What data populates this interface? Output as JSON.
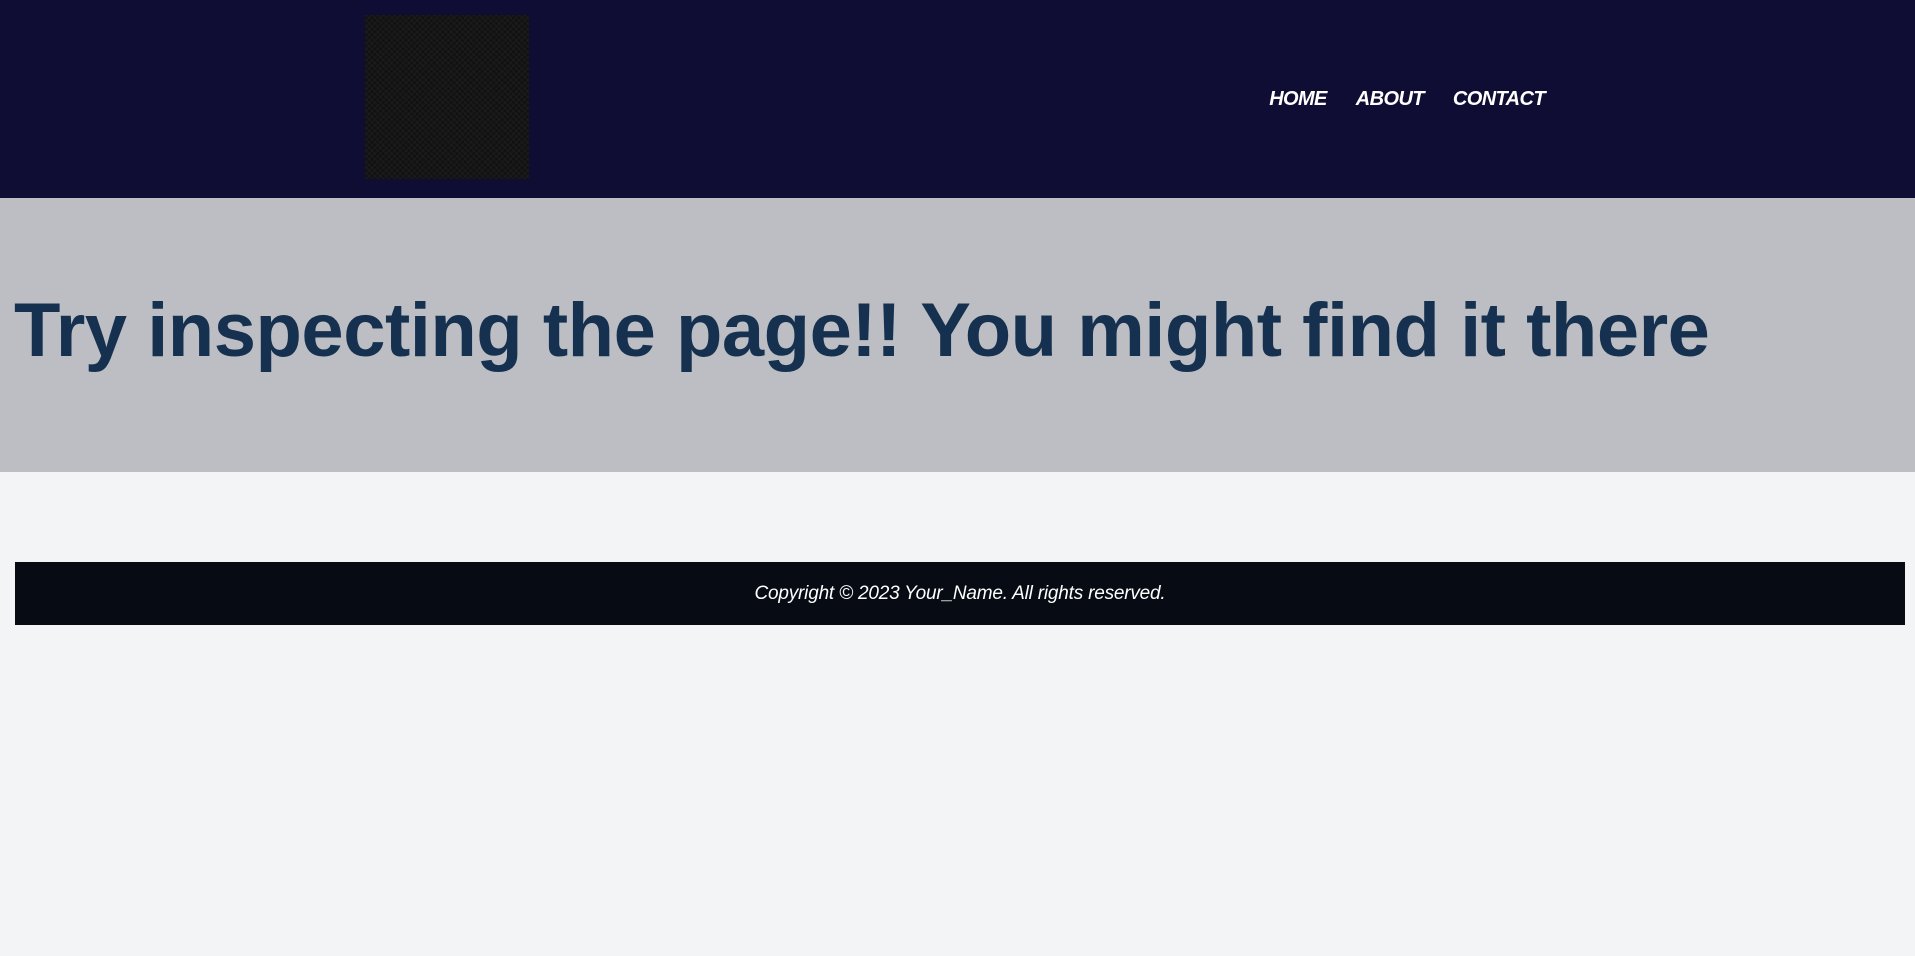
{
  "header": {
    "nav": [
      {
        "label": "HOME"
      },
      {
        "label": "ABOUT"
      },
      {
        "label": "CONTACT"
      }
    ]
  },
  "hero": {
    "heading": "Try inspecting the page!! You might find it there"
  },
  "footer": {
    "copyright": "Copyright © 2023 Your_Name. All rights reserved."
  },
  "colors": {
    "header_bg": "#0f0d34",
    "hero_bg": "#bdbec4",
    "heading": "#15314f",
    "footer_bg": "#070c14",
    "page_bg": "#f3f4f6"
  }
}
